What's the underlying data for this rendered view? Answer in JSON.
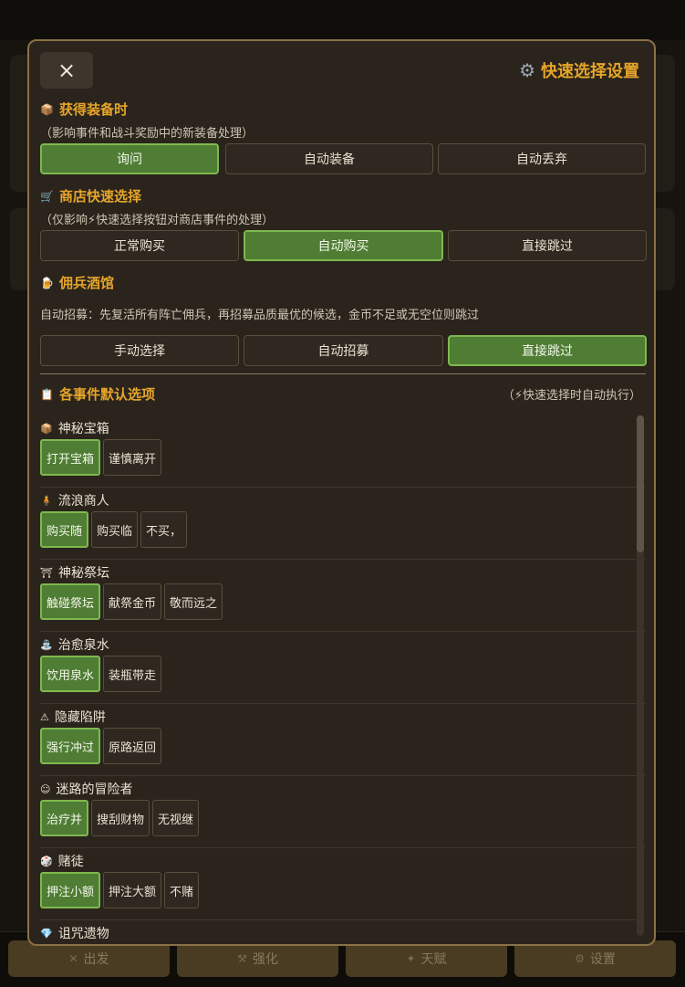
{
  "modal": {
    "title": "快速选择设置",
    "close_label": "×"
  },
  "equipment": {
    "title": "获得装备时",
    "desc": "（影响事件和战斗奖励中的新装备处理）",
    "options": [
      "询问",
      "自动装备",
      "自动丢弃"
    ],
    "selected": 0
  },
  "shop": {
    "title": "商店快速选择",
    "desc": "（仅影响⚡快速选择按钮对商店事件的处理）",
    "options": [
      "正常购买",
      "自动购买",
      "直接跳过"
    ],
    "selected": 1
  },
  "tavern": {
    "title": "佣兵酒馆",
    "desc": "自动招募：先复活所有阵亡佣兵，再招募品质最优的候选，金币不足或无空位则跳过",
    "options": [
      "手动选择",
      "自动招募",
      "直接跳过"
    ],
    "selected": 2
  },
  "events": {
    "title": "各事件默认选项",
    "note": "（⚡快速选择时自动执行）",
    "items": [
      {
        "name": "神秘宝箱",
        "icon": "chest-icon",
        "options": [
          "打开宝箱",
          "谨慎离开"
        ],
        "selected": 0
      },
      {
        "name": "流浪商人",
        "icon": "merchant-icon",
        "options": [
          "购买随",
          "购买临",
          "不买，"
        ],
        "selected": 0
      },
      {
        "name": "神秘祭坛",
        "icon": "torii-icon",
        "options": [
          "触碰祭坛",
          "献祭金币",
          "敬而远之"
        ],
        "selected": 0
      },
      {
        "name": "治愈泉水",
        "icon": "fountain-icon",
        "options": [
          "饮用泉水",
          "装瓶带走"
        ],
        "selected": 0
      },
      {
        "name": "隐藏陷阱",
        "icon": "warning-icon",
        "options": [
          "强行冲过",
          "原路返回"
        ],
        "selected": 0
      },
      {
        "name": "迷路的冒险者",
        "icon": "adventurer-icon",
        "options": [
          "治疗并",
          "搜刮财物",
          "无视继"
        ],
        "selected": 0
      },
      {
        "name": "赌徒",
        "icon": "dice-icon",
        "options": [
          "押注小额",
          "押注大额",
          "不赌"
        ],
        "selected": 0
      },
      {
        "name": "诅咒遗物",
        "icon": "gem-icon",
        "options": [],
        "selected": 0
      }
    ]
  },
  "bottom_nav": [
    "出发",
    "强化",
    "天赋",
    "设置"
  ]
}
